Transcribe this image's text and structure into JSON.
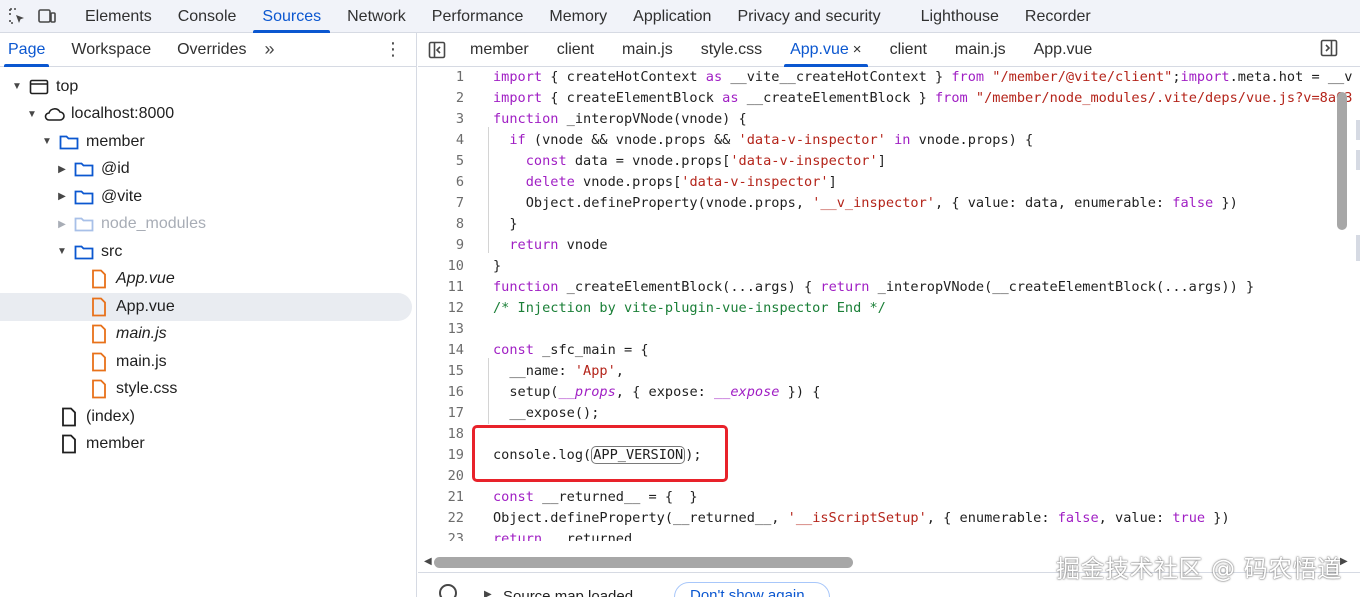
{
  "top_tabs": [
    "Elements",
    "Console",
    "Sources",
    "Network",
    "Performance",
    "Memory",
    "Application",
    "Privacy and security",
    "Lighthouse",
    "Recorder"
  ],
  "top_active": "Sources",
  "left_tabs": [
    "Page",
    "Workspace",
    "Overrides"
  ],
  "left_more": "»",
  "left_kebab": "⋮",
  "tree": [
    {
      "label": "top"
    },
    {
      "label": "localhost:8000"
    },
    {
      "label": "member"
    },
    {
      "label": "@id"
    },
    {
      "label": "@vite"
    },
    {
      "label": "node_modules"
    },
    {
      "label": "src"
    },
    {
      "label": "App.vue"
    },
    {
      "label": "App.vue"
    },
    {
      "label": "main.js"
    },
    {
      "label": "main.js"
    },
    {
      "label": "style.css"
    },
    {
      "label": "(index)"
    },
    {
      "label": "member"
    }
  ],
  "file_tabs": [
    "member",
    "client",
    "main.js",
    "style.css",
    "App.vue",
    "client",
    "main.js",
    "App.vue"
  ],
  "active_file_tab_close": "×",
  "code_line_numbers": [
    "1",
    "2",
    "3",
    "4",
    "5",
    "6",
    "7",
    "8",
    "9",
    "10",
    "11",
    "12",
    "13",
    "14",
    "15",
    "16",
    "17",
    "18",
    "19",
    "20",
    "21",
    "22",
    "23"
  ],
  "info": {
    "message": "Source map loaded",
    "dont_show": "Don't show again"
  },
  "watermark": "掘金技术社区 @ 码农悟道",
  "colors": {
    "accent": "#0b57d0",
    "keyword": "#a01fc4",
    "string": "#b4241a",
    "comment": "#1a7f37",
    "highlight_box": "#e8222a",
    "folder": "#0b57d0",
    "file_orange": "#e8711a"
  }
}
